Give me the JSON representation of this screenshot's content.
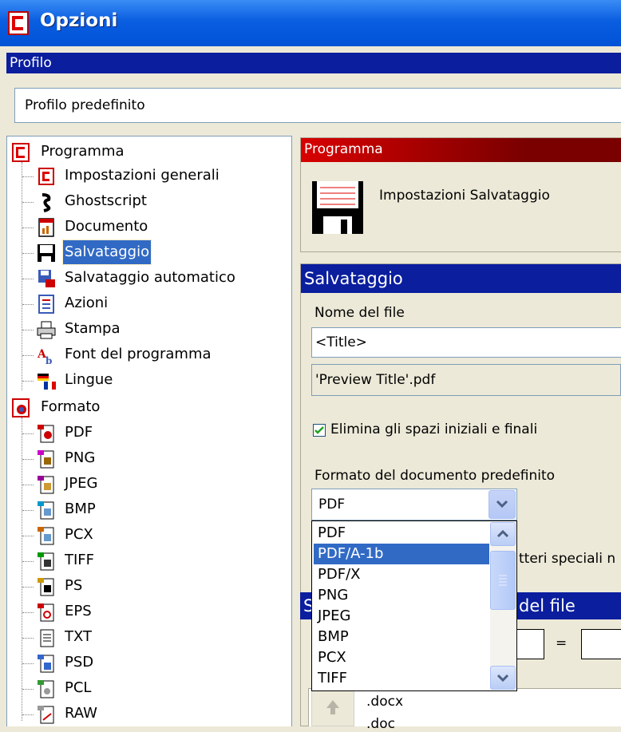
{
  "window": {
    "title": "Opzioni"
  },
  "profile": {
    "header": "Profilo",
    "value": "Profilo predefinito"
  },
  "tree": {
    "groups": [
      {
        "label": "Programma",
        "icon": "program-icon",
        "items": [
          {
            "label": "Impostazioni generali",
            "icon": "general-settings-icon"
          },
          {
            "label": "Ghostscript",
            "icon": "ghostscript-icon"
          },
          {
            "label": "Documento",
            "icon": "document-icon"
          },
          {
            "label": "Salvataggio",
            "icon": "floppy-disk-icon"
          },
          {
            "label": "Salvataggio automatico",
            "icon": "autosave-icon"
          },
          {
            "label": "Azioni",
            "icon": "actions-icon"
          },
          {
            "label": "Stampa",
            "icon": "printer-icon"
          },
          {
            "label": "Font del programma",
            "icon": "font-icon"
          },
          {
            "label": "Lingue",
            "icon": "flags-icon"
          }
        ]
      },
      {
        "label": "Formato",
        "icon": "format-icon",
        "items": [
          {
            "label": "PDF",
            "icon": "pdf-file-icon"
          },
          {
            "label": "PNG",
            "icon": "png-file-icon"
          },
          {
            "label": "JPEG",
            "icon": "jpeg-file-icon"
          },
          {
            "label": "BMP",
            "icon": "bmp-file-icon"
          },
          {
            "label": "PCX",
            "icon": "pcx-file-icon"
          },
          {
            "label": "TIFF",
            "icon": "tiff-file-icon"
          },
          {
            "label": "PS",
            "icon": "ps-file-icon"
          },
          {
            "label": "EPS",
            "icon": "eps-file-icon"
          },
          {
            "label": "TXT",
            "icon": "txt-file-icon"
          },
          {
            "label": "PSD",
            "icon": "psd-file-icon"
          },
          {
            "label": "PCL",
            "icon": "pcl-file-icon"
          },
          {
            "label": "RAW",
            "icon": "raw-file-icon"
          }
        ]
      }
    ],
    "selected": "Salvataggio"
  },
  "program_panel": {
    "header": "Programma",
    "label": "Impostazioni Salvataggio"
  },
  "save_panel": {
    "header": "Salvataggio",
    "filename_label": "Nome del file",
    "filename_value": "<Title>",
    "preview_value": "'Preview Title'.pdf",
    "trim_checkbox_label": "Elimina gli spazi iniziali e finali",
    "trim_checked": true,
    "default_format_label": "Formato del documento predefinito",
    "default_format_value": "PDF",
    "format_options": [
      "PDF",
      "PDF/A-1b",
      "PDF/X",
      "PNG",
      "JPEG",
      "BMP",
      "PCX",
      "TIFF"
    ],
    "highlighted_option": "PDF/A-1b",
    "partial_text_special_chars": "tteri speciali n",
    "partial_header_filename": "del file",
    "equals_sign": "=",
    "extensions": [
      ".docx",
      ".doc"
    ]
  },
  "colors": {
    "title_bar": "#0a5ee0",
    "section_header_blue": "#0a1e9e",
    "section_header_red": "#d80000",
    "selection": "#316ac5"
  }
}
